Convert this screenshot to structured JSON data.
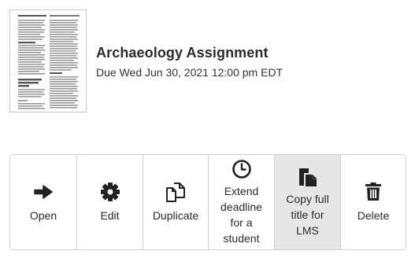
{
  "assignment": {
    "title": "Archaeology Assignment",
    "due": "Due Wed Jun 30, 2021 12:00 pm EDT",
    "thumbnail_icon": "document-thumbnail"
  },
  "actions": [
    {
      "id": "open",
      "label": "Open",
      "icon": "arrow-right-icon",
      "selected": false
    },
    {
      "id": "edit",
      "label": "Edit",
      "icon": "gear-icon",
      "selected": false
    },
    {
      "id": "duplicate",
      "label": "Duplicate",
      "icon": "copy-icon",
      "selected": false
    },
    {
      "id": "extend",
      "label": "Extend\ndeadline\nfor a\nstudent",
      "icon": "clock-icon",
      "selected": false
    },
    {
      "id": "copy-title",
      "label": "Copy full\ntitle for\nLMS",
      "icon": "copy-solid-icon",
      "selected": true
    },
    {
      "id": "delete",
      "label": "Delete",
      "icon": "trash-icon",
      "selected": false
    }
  ],
  "colors": {
    "icon": "#222222",
    "border": "#cfcfcf",
    "selected_bg": "#e6e6e6"
  }
}
